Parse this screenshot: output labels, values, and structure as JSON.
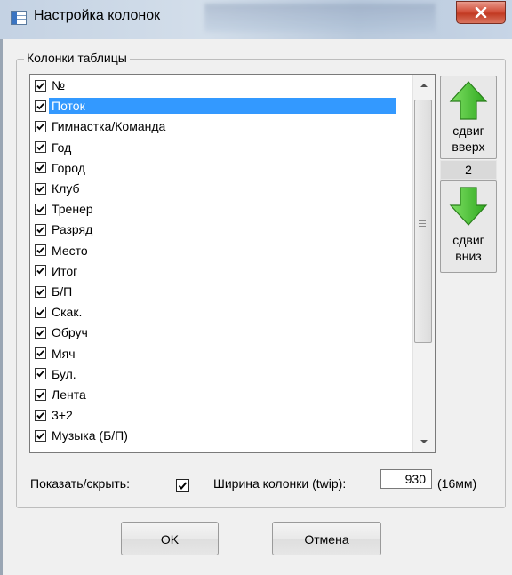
{
  "window": {
    "title": "Настройка колонок"
  },
  "group": {
    "label": "Колонки таблицы"
  },
  "columns": [
    {
      "label": "№",
      "checked": true
    },
    {
      "label": "Поток",
      "checked": true,
      "selected": true
    },
    {
      "label": "Гимнастка/Команда",
      "checked": true
    },
    {
      "label": "Год",
      "checked": true
    },
    {
      "label": "Город",
      "checked": true
    },
    {
      "label": "Клуб",
      "checked": true
    },
    {
      "label": "Тренер",
      "checked": true
    },
    {
      "label": "Разряд",
      "checked": true
    },
    {
      "label": "Место",
      "checked": true
    },
    {
      "label": "Итог",
      "checked": true
    },
    {
      "label": "Б/П",
      "checked": true
    },
    {
      "label": "Скак.",
      "checked": true
    },
    {
      "label": "Обруч",
      "checked": true
    },
    {
      "label": "Мяч",
      "checked": true
    },
    {
      "label": "Бул.",
      "checked": true
    },
    {
      "label": "Лента",
      "checked": true
    },
    {
      "label": "3+2",
      "checked": true
    },
    {
      "label": "Музыка (Б/П)",
      "checked": true
    }
  ],
  "move_up": {
    "line1": "сдвиг",
    "line2": "вверх"
  },
  "position": "2",
  "move_down": {
    "line1": "сдвиг",
    "line2": "вниз"
  },
  "show_hide": {
    "label": "Показать/скрыть:",
    "checked": true
  },
  "width": {
    "label": "Ширина колонки (twip):",
    "value": "930",
    "mm": "(16мм)"
  },
  "buttons": {
    "ok": "OK",
    "cancel": "Отмена"
  },
  "colors": {
    "selection": "#3399ff",
    "arrow_green": "#3fbf2c",
    "close_red": "#c9432b"
  },
  "icons": {
    "title": "table-icon",
    "close": "close-icon",
    "up": "arrow-up-icon",
    "down": "arrow-down-icon"
  }
}
